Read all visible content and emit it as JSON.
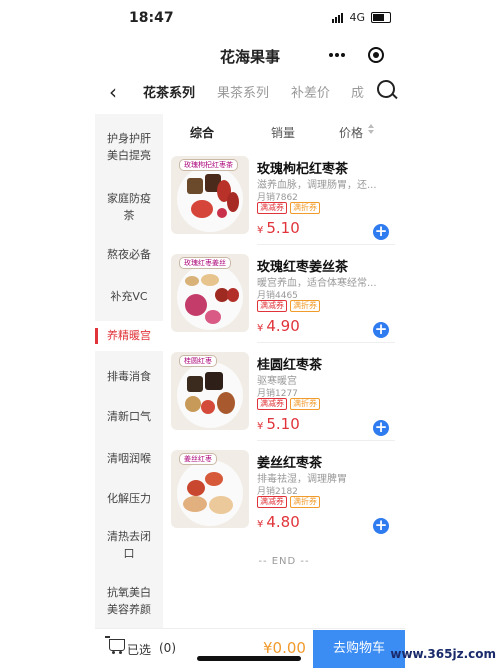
{
  "status": {
    "time": "18:47",
    "network": "4G"
  },
  "header": {
    "title": "花海果事"
  },
  "tabs": [
    {
      "label": "花茶系列",
      "active": true
    },
    {
      "label": "果茶系列",
      "active": false
    },
    {
      "label": "补差价",
      "active": false
    },
    {
      "label": "成",
      "active": false
    }
  ],
  "sidebar": {
    "items": [
      {
        "label": "护身护肝美白提亮"
      },
      {
        "label": "家庭防疫茶"
      },
      {
        "label": "熬夜必备"
      },
      {
        "label": "补充VC"
      },
      {
        "label": "养精暖宫",
        "active": true
      },
      {
        "label": "排毒消食"
      },
      {
        "label": "清新口气"
      },
      {
        "label": "清咽润喉"
      },
      {
        "label": "化解压力"
      },
      {
        "label": "清热去闭口"
      },
      {
        "label": "抗氧美白美容养颜"
      }
    ]
  },
  "sort": {
    "comprehensive": "综合",
    "sales": "销量",
    "price": "价格"
  },
  "products": [
    {
      "name": "玫瑰枸杞红枣茶",
      "desc": "滋养血脉，调理肠胃，还...",
      "sold": "月销7862",
      "coupon1": "满减券",
      "coupon2": "满折券",
      "currency": "¥",
      "price": "5.10",
      "thumb_tag": "玫瑰枸杞红枣茶"
    },
    {
      "name": "玫瑰红枣姜丝茶",
      "desc": "暖宫养血，适合体寒经常...",
      "sold": "月销4465",
      "coupon1": "满减券",
      "coupon2": "满折券",
      "currency": "¥",
      "price": "4.90",
      "thumb_tag": "玫瑰红枣姜丝"
    },
    {
      "name": "桂圆红枣茶",
      "desc": "驱寒暖宫",
      "sold": "月销1277",
      "coupon1": "满减券",
      "coupon2": "满折券",
      "currency": "¥",
      "price": "5.10",
      "thumb_tag": "桂圆红枣"
    },
    {
      "name": "姜丝红枣茶",
      "desc": "排毒祛湿，调理脾胃",
      "sold": "月销2182",
      "coupon1": "满减券",
      "coupon2": "满折券",
      "currency": "¥",
      "price": "4.80",
      "thumb_tag": "姜丝红枣"
    }
  ],
  "list_end": "-- END --",
  "cart": {
    "selected_label": "已选",
    "count": "(0)",
    "total": "¥0.00",
    "checkout": "去购物车"
  },
  "watermark": "www.365jz.com",
  "colors": {
    "accent_red": "#e0343a",
    "accent_blue": "#3b8cf3",
    "accent_orange": "#f19b2c"
  }
}
